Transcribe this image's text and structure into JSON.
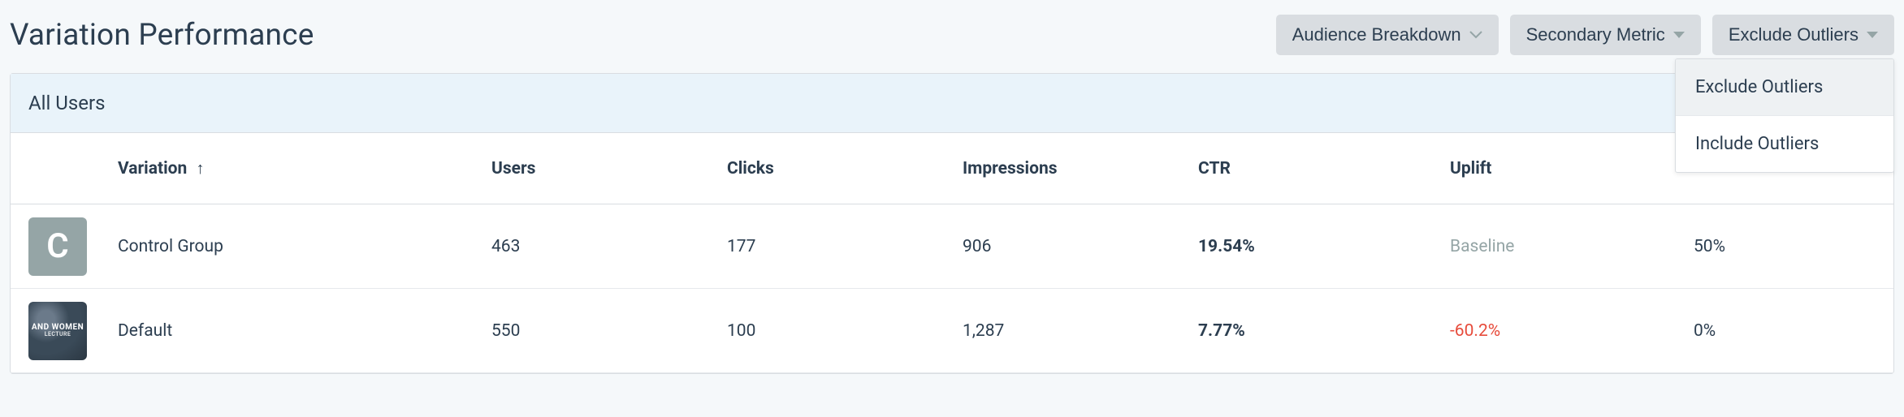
{
  "header": {
    "title": "Variation Performance"
  },
  "controls": {
    "audience_breakdown": {
      "label": "Audience Breakdown"
    },
    "secondary_metric": {
      "label": "Secondary Metric"
    },
    "outliers": {
      "label": "Exclude Outliers",
      "options": [
        "Exclude Outliers",
        "Include Outliers"
      ],
      "selected_index": 0
    }
  },
  "segment": {
    "label": "All Users"
  },
  "columns": {
    "variation": "Variation",
    "users": "Users",
    "clicks": "Clicks",
    "impressions": "Impressions",
    "ctr": "CTR",
    "uplift": "Uplift"
  },
  "sort": {
    "column": "variation",
    "direction": "asc",
    "glyph": "↑"
  },
  "rows": [
    {
      "thumb": {
        "kind": "control",
        "letter": "C"
      },
      "name": "Control Group",
      "users": "463",
      "clicks": "177",
      "impressions": "906",
      "ctr": "19.54%",
      "uplift": {
        "text": "Baseline",
        "style": "muted"
      },
      "conf": "50%"
    },
    {
      "thumb": {
        "kind": "default",
        "line1": "AND WOMEN",
        "line2": "LECTURE"
      },
      "name": "Default",
      "users": "550",
      "clicks": "100",
      "impressions": "1,287",
      "ctr": "7.77%",
      "uplift": {
        "text": "-60.2%",
        "style": "neg"
      },
      "conf": "0%"
    }
  ]
}
